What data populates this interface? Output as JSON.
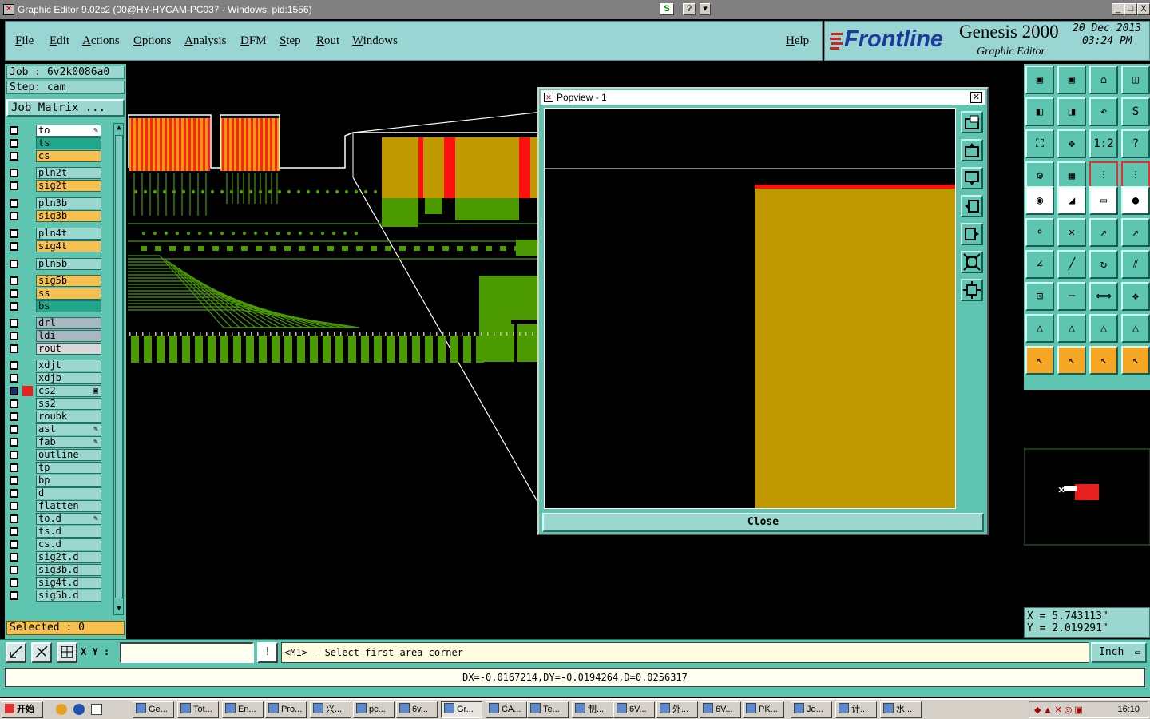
{
  "window": {
    "title": "Graphic Editor 9.02c2 (00@HY-HYCAM-PC037 - Windows, pid:1556)",
    "minimize": "_",
    "maximize": "□",
    "close": "X"
  },
  "menu": {
    "items": [
      "File",
      "Edit",
      "Actions",
      "Options",
      "Analysis",
      "DFM",
      "Step",
      "Rout",
      "Windows"
    ],
    "help": "Help"
  },
  "brand": {
    "logo": "Frontline",
    "product": "Genesis 2000",
    "subtitle": "Graphic Editor",
    "date": "20 Dec 2013",
    "time": "03:24 PM"
  },
  "job": {
    "job_label": "Job : 6v2k0086a0",
    "step_label": "Step: cam",
    "matrix_button": "Job Matrix ..."
  },
  "layers": [
    {
      "name": "to",
      "color": "#ffffff",
      "edit": true
    },
    {
      "name": "ts",
      "color": "#1fa88c"
    },
    {
      "name": "cs",
      "color": "#f5c050"
    },
    {
      "name": "pln2t",
      "color": "#9ad8cf"
    },
    {
      "name": "sig2t",
      "color": "#f5c050"
    },
    {
      "name": "pln3b",
      "color": "#9ad8cf"
    },
    {
      "name": "sig3b",
      "color": "#f5c050"
    },
    {
      "name": "pln4t",
      "color": "#9ad8cf"
    },
    {
      "name": "sig4t",
      "color": "#f5c050"
    },
    {
      "name": "pln5b",
      "color": "#9ad8cf"
    },
    {
      "name": "sig5b",
      "color": "#f5c050"
    },
    {
      "name": "ss",
      "color": "#f5c050"
    },
    {
      "name": "bs",
      "color": "#1fa88c"
    },
    {
      "name": "drl",
      "color": "#a8b8c0"
    },
    {
      "name": "ldi",
      "color": "#a8b8c0"
    },
    {
      "name": "rout",
      "color": "#d8d8d8"
    },
    {
      "name": "xdjt",
      "color": "#9ad8cf"
    },
    {
      "name": "xdjb",
      "color": "#9ad8cf"
    },
    {
      "name": "cs2",
      "color": "#9ad8cf",
      "active": true
    },
    {
      "name": "ss2",
      "color": "#9ad8cf"
    },
    {
      "name": "roubk",
      "color": "#9ad8cf"
    },
    {
      "name": "ast",
      "color": "#9ad8cf",
      "edit": true
    },
    {
      "name": "fab",
      "color": "#9ad8cf",
      "edit": true
    },
    {
      "name": "outline",
      "color": "#9ad8cf"
    },
    {
      "name": "tp",
      "color": "#9ad8cf"
    },
    {
      "name": "bp",
      "color": "#9ad8cf"
    },
    {
      "name": "d",
      "color": "#9ad8cf"
    },
    {
      "name": "flatten",
      "color": "#9ad8cf"
    },
    {
      "name": "to.d",
      "color": "#9ad8cf",
      "edit": true
    },
    {
      "name": "ts.d",
      "color": "#9ad8cf"
    },
    {
      "name": "cs.d",
      "color": "#9ad8cf"
    },
    {
      "name": "sig2t.d",
      "color": "#9ad8cf"
    },
    {
      "name": "sig3b.d",
      "color": "#9ad8cf"
    },
    {
      "name": "sig4t.d",
      "color": "#9ad8cf"
    },
    {
      "name": "sig5b.d",
      "color": "#9ad8cf"
    }
  ],
  "selected": "Selected : 0",
  "popview": {
    "title": "Popview - 1",
    "close_label": "Close"
  },
  "coords": {
    "x": "X  =  5.743113\"",
    "y": "Y  =  2.019291\""
  },
  "command": {
    "xy_label": "X Y :",
    "xy_value": "",
    "prompt": "<M1> - Select first area corner",
    "unit": "Inch"
  },
  "status": "DX=-0.0167214,DY=-0.0194264,D=0.0256317",
  "taskbar": {
    "start": "开始",
    "tasks": [
      "Ge...",
      "Tot...",
      "En...",
      "Pro...",
      "兴...",
      "pc...",
      "6v...",
      "Gr...",
      "CA...",
      "Te...",
      "制...",
      "6V...",
      "外...",
      "6V...",
      "PK...",
      "Jo...",
      "计...",
      "水..."
    ],
    "clock": "16:10"
  },
  "colors": {
    "panel": "#5ec6b0",
    "copper": "#c09800",
    "green": "#4a9a00",
    "highlight": "#ff1010"
  }
}
